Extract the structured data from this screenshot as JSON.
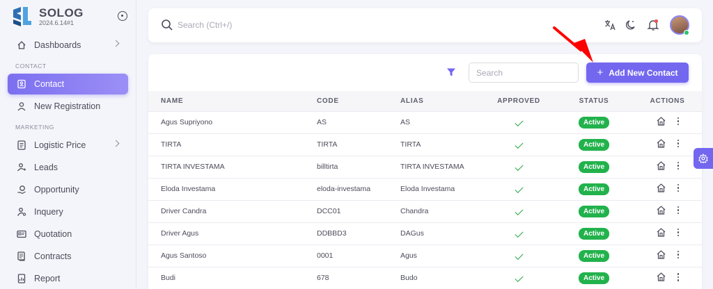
{
  "brand": {
    "name": "SOLOG",
    "version": "2024.6.14#1"
  },
  "sidebar": {
    "items": [
      {
        "label": "Dashboards",
        "icon": "home-icon",
        "chevron": true
      },
      {
        "section": "CONTACT"
      },
      {
        "label": "Contact",
        "icon": "contact-icon",
        "active": true
      },
      {
        "label": "New Registration",
        "icon": "user-icon"
      },
      {
        "section": "MARKETING"
      },
      {
        "label": "Logistic Price",
        "icon": "list-icon",
        "chevron": true
      },
      {
        "label": "Leads",
        "icon": "leads-icon"
      },
      {
        "label": "Opportunity",
        "icon": "opportunity-icon"
      },
      {
        "label": "Inquery",
        "icon": "inquery-icon"
      },
      {
        "label": "Quotation",
        "icon": "quotation-icon"
      },
      {
        "label": "Contracts",
        "icon": "contracts-icon"
      },
      {
        "label": "Report",
        "icon": "report-icon"
      }
    ]
  },
  "topbar": {
    "search_placeholder": "Search (Ctrl+/)"
  },
  "toolbar": {
    "search_placeholder": "Search",
    "add_label": "Add New Contact"
  },
  "table": {
    "headers": [
      "NAME",
      "CODE",
      "ALIAS",
      "APPROVED",
      "STATUS",
      "ACTIONS"
    ],
    "rows": [
      {
        "name": "Agus Supriyono",
        "code": "AS",
        "alias": "AS",
        "status": "Active"
      },
      {
        "name": "TIRTA",
        "code": "TIRTA",
        "alias": "TIRTA",
        "status": "Active"
      },
      {
        "name": "TIRTA INVESTAMA",
        "code": "billtirta",
        "alias": "TIRTA INVESTAMA",
        "status": "Active"
      },
      {
        "name": "Eloda Investama",
        "code": "eloda-investama",
        "alias": "Eloda Investama",
        "status": "Active"
      },
      {
        "name": "Driver Candra",
        "code": "DCC01",
        "alias": "Chandra",
        "status": "Active"
      },
      {
        "name": "Driver Agus",
        "code": "DDBBD3",
        "alias": "DAGus",
        "status": "Active"
      },
      {
        "name": "Agus Santoso",
        "code": "0001",
        "alias": "Agus",
        "status": "Active"
      },
      {
        "name": "Budi",
        "code": "678",
        "alias": "Budo",
        "status": "Active"
      }
    ]
  },
  "colors": {
    "primary": "#7367f0",
    "success": "#22b24c",
    "annotation": "#ff0000"
  }
}
